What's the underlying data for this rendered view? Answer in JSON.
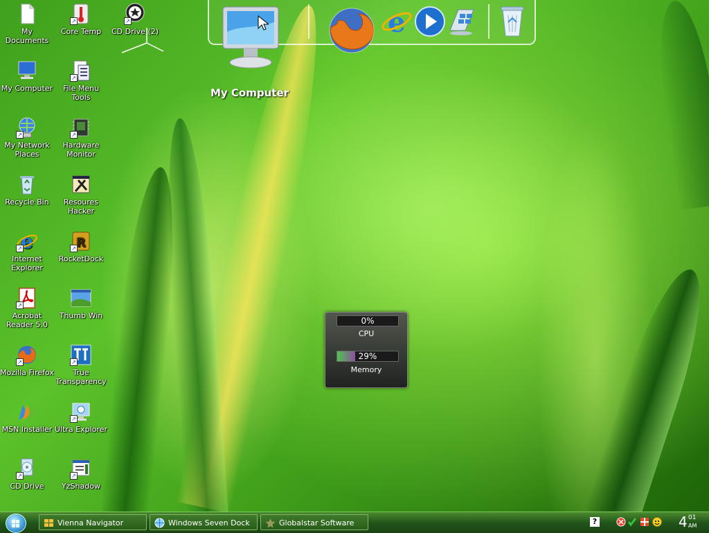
{
  "desktop_icons": [
    {
      "label": "My Documents",
      "icon": "document-icon"
    },
    {
      "label": "Core Temp",
      "icon": "thermometer-icon"
    },
    {
      "label": "CD Drive (2)",
      "icon": "cd-drive-icon"
    },
    {
      "label": "My Computer",
      "icon": "computer-icon"
    },
    {
      "label": "File Menu Tools",
      "icon": "file-menu-icon"
    },
    {
      "label": "My Network Places",
      "icon": "network-icon"
    },
    {
      "label": "Hardware Monitor",
      "icon": "chip-icon"
    },
    {
      "label": "Recycle Bin",
      "icon": "recycle-bin-icon"
    },
    {
      "label": "Resoures Hacker",
      "icon": "hacker-icon"
    },
    {
      "label": "Internet Explorer",
      "icon": "ie-icon"
    },
    {
      "label": "RocketDock",
      "icon": "rocketdock-icon"
    },
    {
      "label": "Acrobat Reader 5.0",
      "icon": "acrobat-icon"
    },
    {
      "label": "Thumb Win",
      "icon": "thumbnail-icon"
    },
    {
      "label": "Mozilla Firefox",
      "icon": "firefox-icon"
    },
    {
      "label": "True Transparency",
      "icon": "transparency-icon"
    },
    {
      "label": "MSN Installer",
      "icon": "msn-icon"
    },
    {
      "label": "Ultra Explorer",
      "icon": "explorer-icon"
    },
    {
      "label": "CD Drive",
      "icon": "cd-drive-icon"
    },
    {
      "label": "YzShadow",
      "icon": "shadow-icon"
    }
  ],
  "dock": {
    "hover_label": "My Computer",
    "items": [
      "computer-icon",
      "firefox-icon",
      "ie-icon",
      "media-player-icon",
      "windows-update-icon",
      "recycle-bin-icon"
    ]
  },
  "meter": {
    "cpu_value": "0%",
    "cpu_fraction": 0,
    "cpu_label": "CPU",
    "memory_value": "29%",
    "memory_fraction": 0.29,
    "memory_label": "Memory"
  },
  "taskbar": {
    "tasks": [
      {
        "label": "Vienna Navigator",
        "icon": "windows-flag-icon"
      },
      {
        "label": "Windows Seven Dock",
        "icon": "globe-icon"
      },
      {
        "label": "Globalstar Software",
        "icon": "star-icon"
      }
    ],
    "tray_icons": [
      "help-icon",
      "shield-icon",
      "check-icon",
      "network-tray-icon",
      "emoticon-icon"
    ],
    "clock": {
      "hour": "4",
      "minute": "01",
      "ampm": "AM"
    }
  }
}
